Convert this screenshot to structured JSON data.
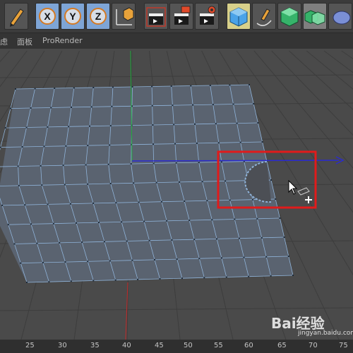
{
  "toolbar": {
    "axis_x": "X",
    "axis_y": "Y",
    "axis_z": "Z"
  },
  "menubar": {
    "item_partial": "虑",
    "item_panel": "面板",
    "item_prorender": "ProRender"
  },
  "ruler": {
    "ticks": [
      "25",
      "30",
      "35",
      "40",
      "45",
      "50",
      "55",
      "60",
      "65",
      "70",
      "75"
    ]
  },
  "watermark": {
    "brand": "Bai经验",
    "url": "jingyan.baidu.com"
  },
  "colors": {
    "highlight_box": "#e01b1b",
    "mesh_edge": "#8fb3d9",
    "axis_x": "#2a2ad0",
    "axis_y": "#1fa83a",
    "axis_z": "#c42a2a"
  }
}
